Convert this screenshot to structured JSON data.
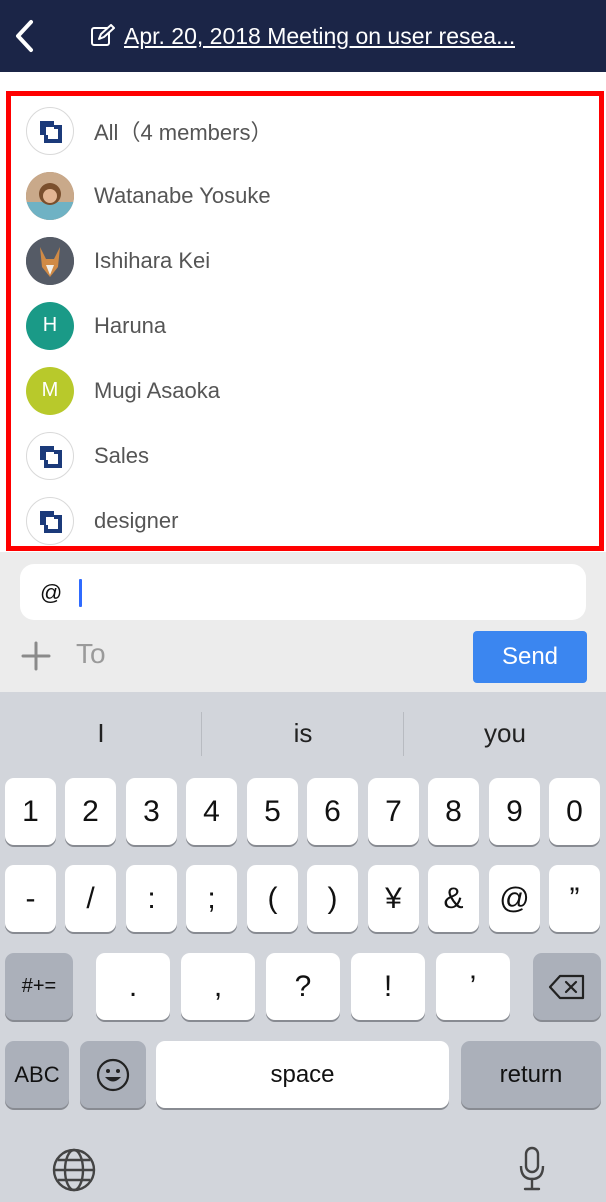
{
  "header": {
    "title": "Apr. 20, 2018 Meeting on user resea..."
  },
  "mention_list": [
    {
      "label": "All（4 members）",
      "avatar_type": "group-icon"
    },
    {
      "label": "Watanabe Yosuke",
      "avatar_type": "photo"
    },
    {
      "label": "Ishihara Kei",
      "avatar_type": "photo"
    },
    {
      "label": "Haruna",
      "avatar_type": "letter",
      "letter": "H",
      "color": "#1a9a87"
    },
    {
      "label": "Mugi Asaoka",
      "avatar_type": "letter",
      "letter": "M",
      "color": "#b8c92b"
    },
    {
      "label": "Sales",
      "avatar_type": "group-icon"
    },
    {
      "label": "designer",
      "avatar_type": "group-icon"
    }
  ],
  "compose": {
    "text": "@",
    "to_label": "To",
    "send_label": "Send"
  },
  "keyboard": {
    "suggestions": [
      "I",
      "is",
      "you"
    ],
    "row1": [
      "1",
      "2",
      "3",
      "4",
      "5",
      "6",
      "7",
      "8",
      "9",
      "0"
    ],
    "row2": [
      "-",
      "/",
      ":",
      ";",
      "(",
      ")",
      "¥",
      "&",
      "@",
      "”"
    ],
    "row3": [
      ".",
      ",",
      "?",
      "!",
      "’"
    ],
    "symbols_label": "#+=",
    "abc_label": "ABC",
    "space_label": "space",
    "return_label": "return"
  },
  "colors": {
    "header_bg": "#1b2547",
    "highlight_border": "#ff0000",
    "send_button": "#3b86f0",
    "brand_icon": "#1b3a7a"
  }
}
